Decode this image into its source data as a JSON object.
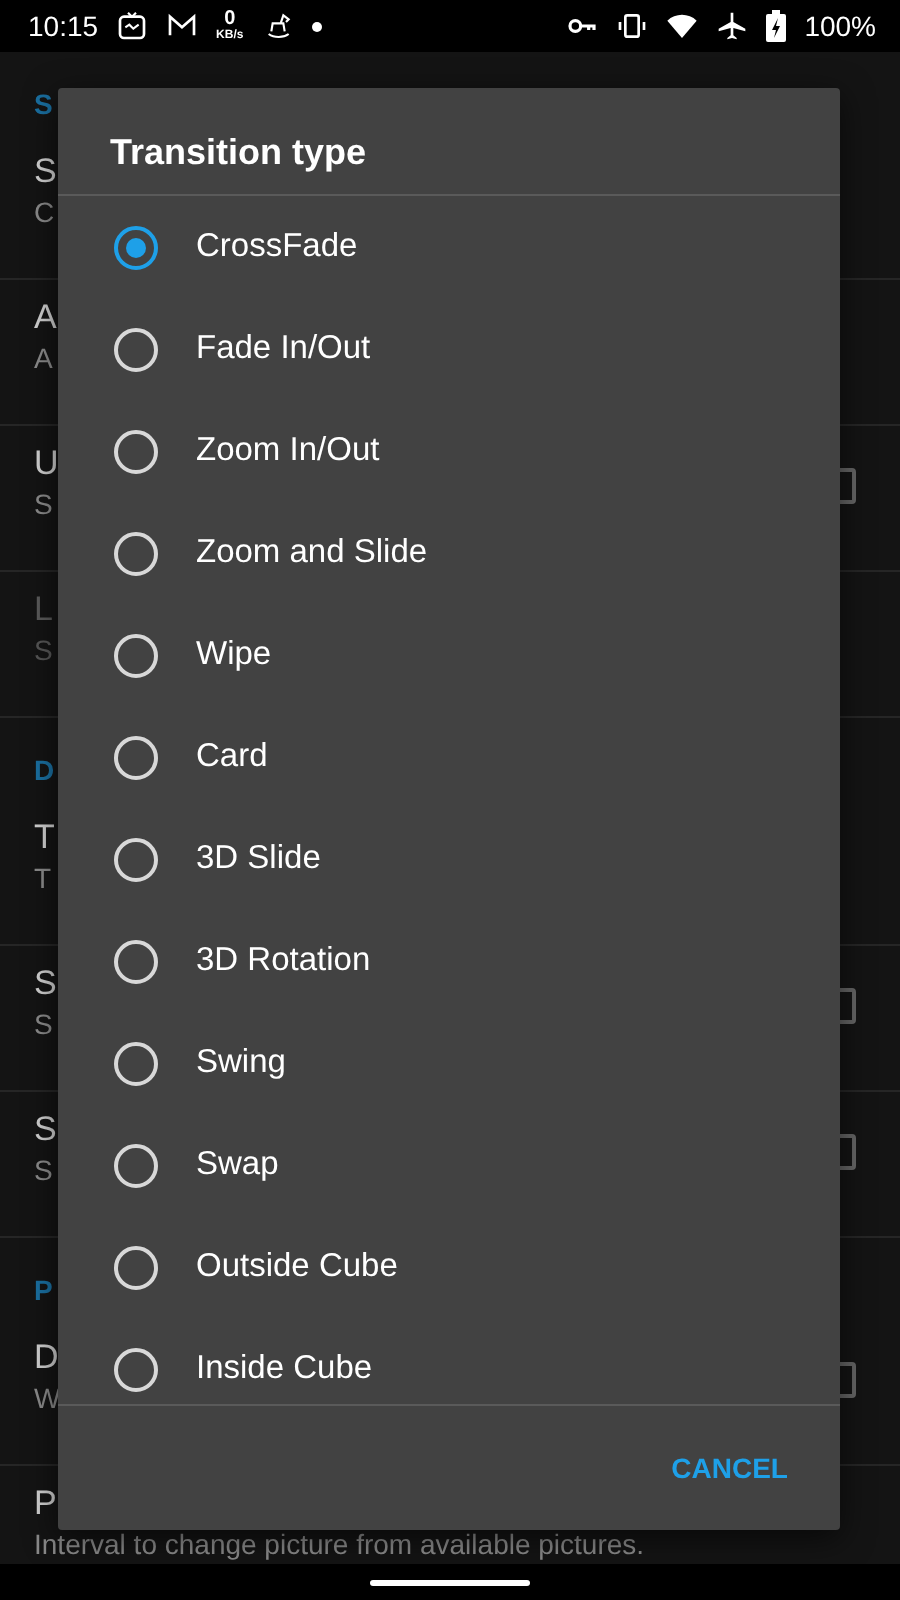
{
  "status_bar": {
    "time": "10:15",
    "speed_value": "0",
    "speed_unit": "KB/s",
    "battery": "100%"
  },
  "settings": [
    {
      "kind": "header",
      "title": "S"
    },
    {
      "kind": "pref",
      "title": "S",
      "summary": "C",
      "disabled": false
    },
    {
      "kind": "pref",
      "title": "A",
      "summary": "A",
      "disabled": false
    },
    {
      "kind": "checkbox",
      "title": "U",
      "summary": "S",
      "disabled": false
    },
    {
      "kind": "pref",
      "title": "L",
      "summary": "S",
      "disabled": true
    },
    {
      "kind": "header",
      "title": "D"
    },
    {
      "kind": "pref",
      "title": "T",
      "summary": "T",
      "disabled": false
    },
    {
      "kind": "checkbox",
      "title": "S",
      "summary": "S",
      "disabled": false
    },
    {
      "kind": "checkbox",
      "title": "S",
      "summary": "S",
      "disabled": false
    },
    {
      "kind": "header",
      "title": "P"
    },
    {
      "kind": "checkbox",
      "title": "D",
      "summary": "W",
      "disabled": false
    },
    {
      "kind": "pref",
      "title": "P",
      "summary": "Interval to change picture from available pictures.",
      "disabled": false
    }
  ],
  "dialog": {
    "title": "Transition type",
    "options": [
      {
        "label": "CrossFade",
        "selected": true
      },
      {
        "label": "Fade In/Out",
        "selected": false
      },
      {
        "label": "Zoom In/Out",
        "selected": false
      },
      {
        "label": "Zoom and Slide",
        "selected": false
      },
      {
        "label": "Wipe",
        "selected": false
      },
      {
        "label": "Card",
        "selected": false
      },
      {
        "label": "3D Slide",
        "selected": false
      },
      {
        "label": "3D Rotation",
        "selected": false
      },
      {
        "label": "Swing",
        "selected": false
      },
      {
        "label": "Swap",
        "selected": false
      },
      {
        "label": "Outside Cube",
        "selected": false
      },
      {
        "label": "Inside Cube",
        "selected": false
      }
    ],
    "button": "CANCEL"
  }
}
